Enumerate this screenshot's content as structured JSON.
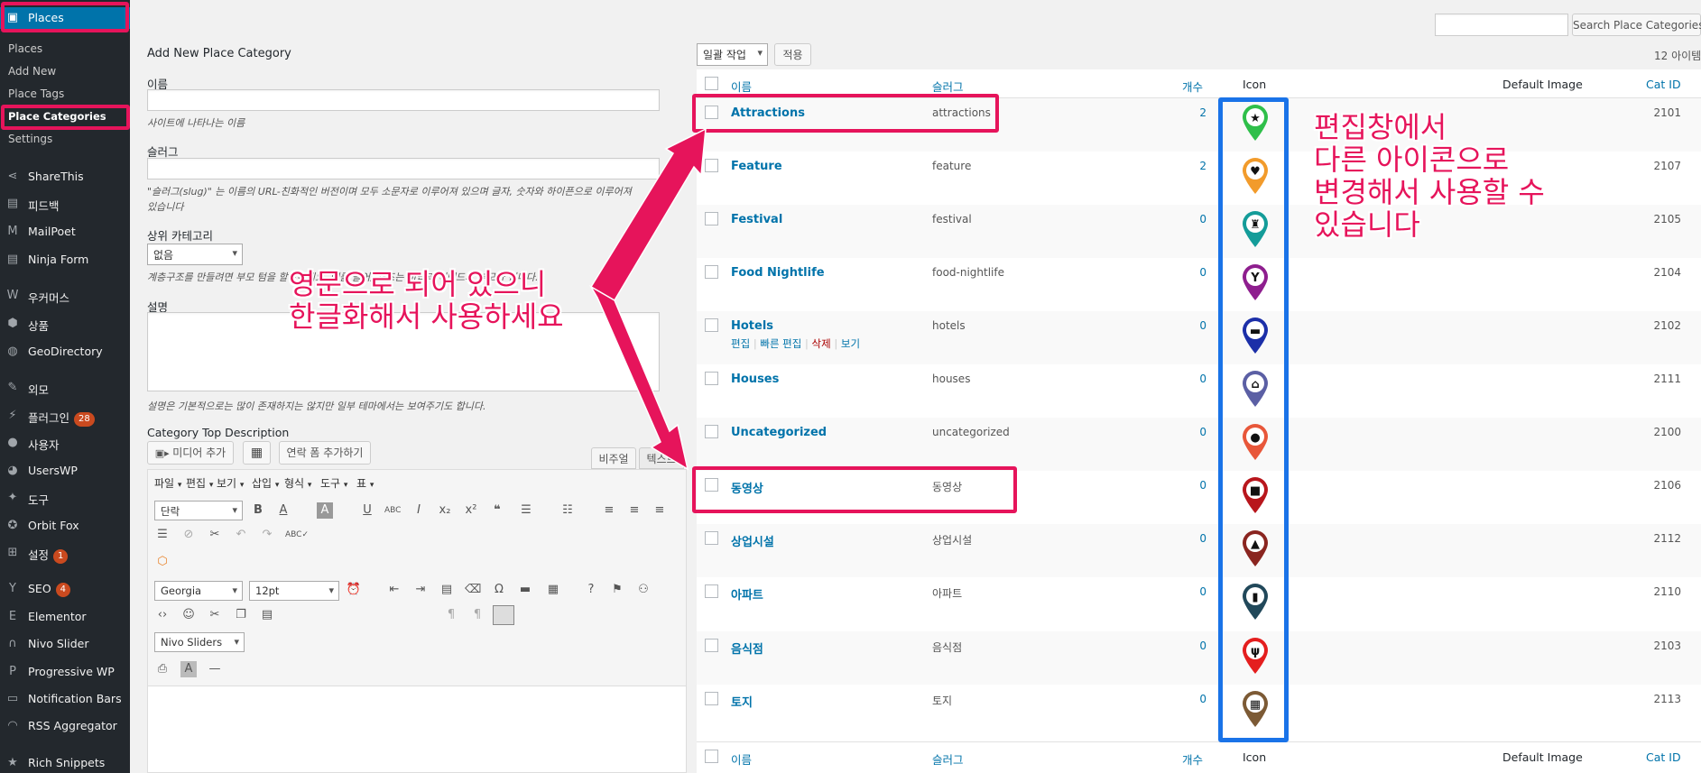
{
  "sidebar": {
    "top_label": "Places",
    "sub_items": [
      "Places",
      "Add New",
      "Place Tags",
      "Place Categories",
      "Settings"
    ],
    "items": [
      {
        "label": "ShareThis",
        "icon": "share-icon"
      },
      {
        "label": "피드백",
        "icon": "feedback-icon"
      },
      {
        "label": "MailPoet",
        "icon": "mailpoet-icon"
      },
      {
        "label": "Ninja Form",
        "icon": "form-icon"
      },
      {
        "label": "우커머스",
        "icon": "woo-icon"
      },
      {
        "label": "상품",
        "icon": "product-icon"
      },
      {
        "label": "GeoDirectory",
        "icon": "globe-icon"
      },
      {
        "label": "외모",
        "icon": "brush-icon"
      },
      {
        "label": "플러그인",
        "icon": "plugin-icon",
        "badge": "28"
      },
      {
        "label": "사용자",
        "icon": "user-icon"
      },
      {
        "label": "UsersWP",
        "icon": "users-icon"
      },
      {
        "label": "도구",
        "icon": "tools-icon"
      },
      {
        "label": "Orbit Fox",
        "icon": "fox-icon"
      },
      {
        "label": "설정",
        "icon": "settings-icon",
        "badge": "1"
      },
      {
        "label": "SEO",
        "icon": "seo-icon",
        "badge": "4"
      },
      {
        "label": "Elementor",
        "icon": "elementor-icon"
      },
      {
        "label": "Nivo Slider",
        "icon": "slider-icon"
      },
      {
        "label": "Progressive WP",
        "icon": "pwa-icon"
      },
      {
        "label": "Notification Bars",
        "icon": "bell-icon"
      },
      {
        "label": "RSS Aggregator",
        "icon": "rss-icon"
      },
      {
        "label": "Rich Snippets",
        "icon": "star-icon"
      }
    ]
  },
  "form": {
    "heading": "Add New Place Category",
    "name_label": "이름",
    "name_desc": "사이트에 나타나는 이름",
    "slug_label": "슬러그",
    "slug_desc_1": "\"슬러그(slug)\" 는 이름의 URL-친화적인 버전이며 모두 소문자로 이루어져 있으며 글자, 숫자와 하이픈으로 이루어져",
    "slug_desc_2": "있습니다",
    "parent_label": "상위 카테고리",
    "parent_value": "없음",
    "parent_desc": "계층구조를 만들려면 부모 텀을 할당하세요. 예를 들어, 재즈는 비밥과 빅밴드의 부모가 됩니다.",
    "desc_label": "설명",
    "desc_desc": "설명은 기본적으로는 많이 존재하지는 않지만 일부 테마에서는 보여주기도 합니다.",
    "top_desc_label": "Category Top Description",
    "media_button": "미디어 추가",
    "contact_button": "연락 폼 추가하기",
    "tab_visual": "비주얼",
    "tab_text": "텍스트",
    "menu": [
      "파일",
      "편집",
      "보기",
      "삽입",
      "형식",
      "도구",
      "표"
    ],
    "format_value": "단락",
    "font_value": "Georgia",
    "size_value": "12pt",
    "nivo_value": "Nivo Sliders"
  },
  "toolbar": {
    "bulk_label": "일괄 작업",
    "apply_label": "적용",
    "search_button": "Search Place Categories",
    "search_placeholder": "",
    "items_count": "12 아이템"
  },
  "table": {
    "columns": {
      "name": "이름",
      "slug": "슬러그",
      "count": "개수",
      "icon": "Icon",
      "image": "Default Image",
      "id": "Cat ID"
    },
    "row_actions": [
      "편집",
      "빠른 편집",
      "삭제",
      "보기"
    ],
    "rows": [
      {
        "name": "Attractions",
        "slug": "attractions",
        "count": "2",
        "id": "2101",
        "icon": "star-pin-icon",
        "color": "#2fbf4a",
        "glyph": "★"
      },
      {
        "name": "Feature",
        "slug": "feature",
        "count": "2",
        "id": "2107",
        "icon": "heart-pin-icon",
        "color": "#f29b2b",
        "glyph": "♥"
      },
      {
        "name": "Festival",
        "slug": "festival",
        "count": "0",
        "id": "2105",
        "icon": "festival-pin-icon",
        "color": "#149c99",
        "glyph": "♜"
      },
      {
        "name": "Food Nightlife",
        "slug": "food-nightlife",
        "count": "0",
        "id": "2104",
        "icon": "cocktail-pin-icon",
        "color": "#8e1e8e",
        "glyph": "Y"
      },
      {
        "name": "Hotels",
        "slug": "hotels",
        "count": "0",
        "id": "2102",
        "icon": "bed-pin-icon",
        "color": "#1c2fa8",
        "glyph": "▬"
      },
      {
        "name": "Houses",
        "slug": "houses",
        "count": "0",
        "id": "2111",
        "icon": "bank-pin-icon",
        "color": "#5b5fa4",
        "glyph": "⌂"
      },
      {
        "name": "Uncategorized",
        "slug": "uncategorized",
        "count": "0",
        "id": "2100",
        "icon": "globe-pin-icon",
        "color": "#e8573a",
        "glyph": "●"
      },
      {
        "name": "동영상",
        "slug": "동영상",
        "count": "0",
        "id": "2106",
        "icon": "video-pin-icon",
        "color": "#b8161c",
        "glyph": "■"
      },
      {
        "name": "상업시설",
        "slug": "상업시설",
        "count": "0",
        "id": "2112",
        "icon": "factory-pin-icon",
        "color": "#8a2520",
        "glyph": "▲"
      },
      {
        "name": "아파트",
        "slug": "아파트",
        "count": "0",
        "id": "2110",
        "icon": "building-pin-icon",
        "color": "#21485a",
        "glyph": "▮"
      },
      {
        "name": "음식점",
        "slug": "음식점",
        "count": "0",
        "id": "2103",
        "icon": "fork-pin-icon",
        "color": "#e41e1e",
        "glyph": "ψ"
      },
      {
        "name": "토지",
        "slug": "토지",
        "count": "0",
        "id": "2113",
        "icon": "map-pin-icon",
        "color": "#7c5a35",
        "glyph": "▦"
      }
    ]
  },
  "annotations": {
    "left_line1": "영문으로 되어 있으니",
    "left_line2": "한글화해서 사용하세요",
    "right_line1": "편집창에서",
    "right_line2": "다른 아이콘으로",
    "right_line3": "변경해서 사용할 수",
    "right_line4": "있습니다",
    "highlight_color": "#e6145b",
    "icon_box_color": "#1a73e8"
  }
}
